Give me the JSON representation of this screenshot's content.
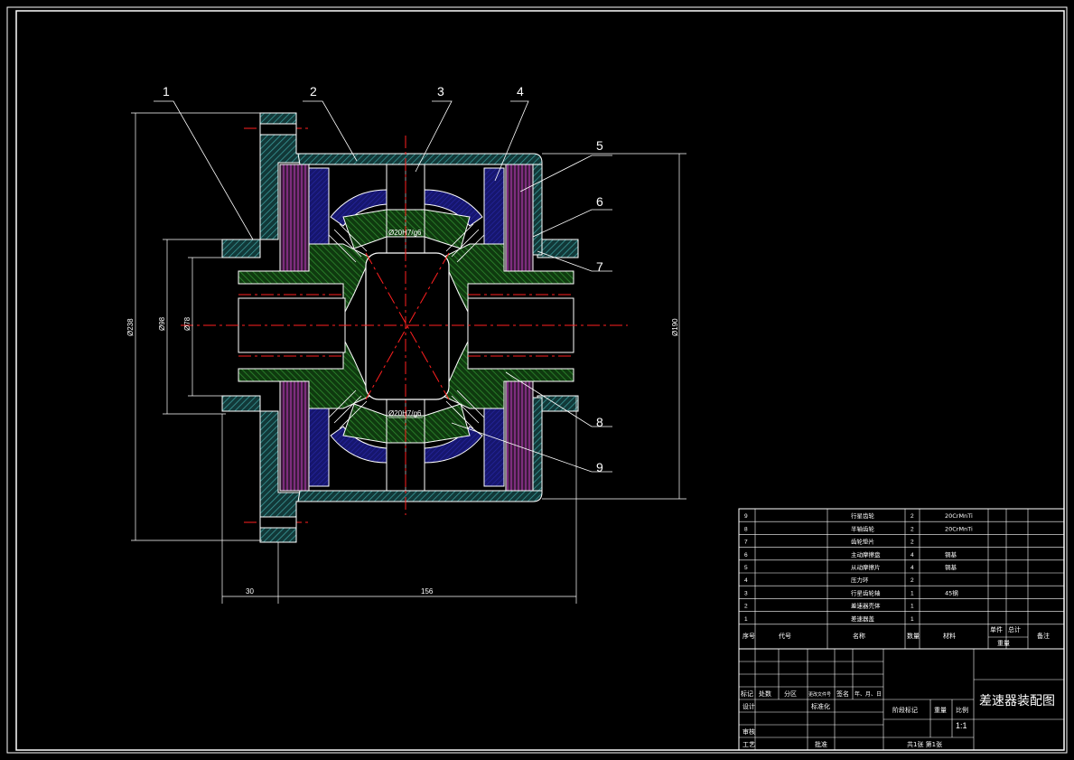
{
  "colors": {
    "background": "#000000",
    "line": "#ffffff",
    "hatch_cyan": "#3a9a9a",
    "hatch_green": "#2e8a2e",
    "blue_part": "#1a1a8a",
    "red_center": "#ff2020",
    "magenta": "#c040c0"
  },
  "callouts": [
    {
      "num": "1"
    },
    {
      "num": "2"
    },
    {
      "num": "3"
    },
    {
      "num": "4"
    },
    {
      "num": "5"
    },
    {
      "num": "6"
    },
    {
      "num": "7"
    },
    {
      "num": "8"
    },
    {
      "num": "9"
    }
  ],
  "dimensions": {
    "d238": "Ø238",
    "d98": "Ø98",
    "d78": "Ø78",
    "d190": "Ø190",
    "w30": "30",
    "w156": "156",
    "fit_top": "Ø20H7/g6",
    "fit_bottom": "Ø20H7/g6"
  },
  "bom": {
    "rows": [
      {
        "seq": "9",
        "name": "行星齿轮",
        "qty": "2",
        "material": "20CrMnTi"
      },
      {
        "seq": "8",
        "name": "半轴齿轮",
        "qty": "2",
        "material": "20CrMnTi"
      },
      {
        "seq": "7",
        "name": "齿轮垫片",
        "qty": "2",
        "material": ""
      },
      {
        "seq": "6",
        "name": "主动摩擦盘",
        "qty": "4",
        "material": "铜基"
      },
      {
        "seq": "5",
        "name": "从动摩擦片",
        "qty": "4",
        "material": "铜基"
      },
      {
        "seq": "4",
        "name": "压力环",
        "qty": "2",
        "material": ""
      },
      {
        "seq": "3",
        "name": "行星齿轮轴",
        "qty": "1",
        "material": "45钢"
      },
      {
        "seq": "2",
        "name": "差速器壳体",
        "qty": "1",
        "material": ""
      },
      {
        "seq": "1",
        "name": "差速器盖",
        "qty": "1",
        "material": ""
      }
    ],
    "header": {
      "seq": "序号",
      "code": "代号",
      "name": "名称",
      "qty": "数量",
      "material": "材料",
      "unit": "单件",
      "total": "总计",
      "weight": "重量",
      "remark": "备注"
    }
  },
  "title_block": {
    "title": "差速器装配图",
    "mark_label": "标记",
    "count_label": "处数",
    "zone_label": "分区",
    "doc_label": "更改文件号",
    "sign_label": "签名",
    "date_label": "年、月、日",
    "design_label": "设计",
    "std_label": "标准化",
    "stage_label": "阶段标记",
    "weight_label": "重量",
    "scale_label": "比例",
    "scale_value": "1:1",
    "review_label": "审核",
    "process_label": "工艺",
    "approve_label": "批准",
    "sheets": "共1张 第1张"
  }
}
